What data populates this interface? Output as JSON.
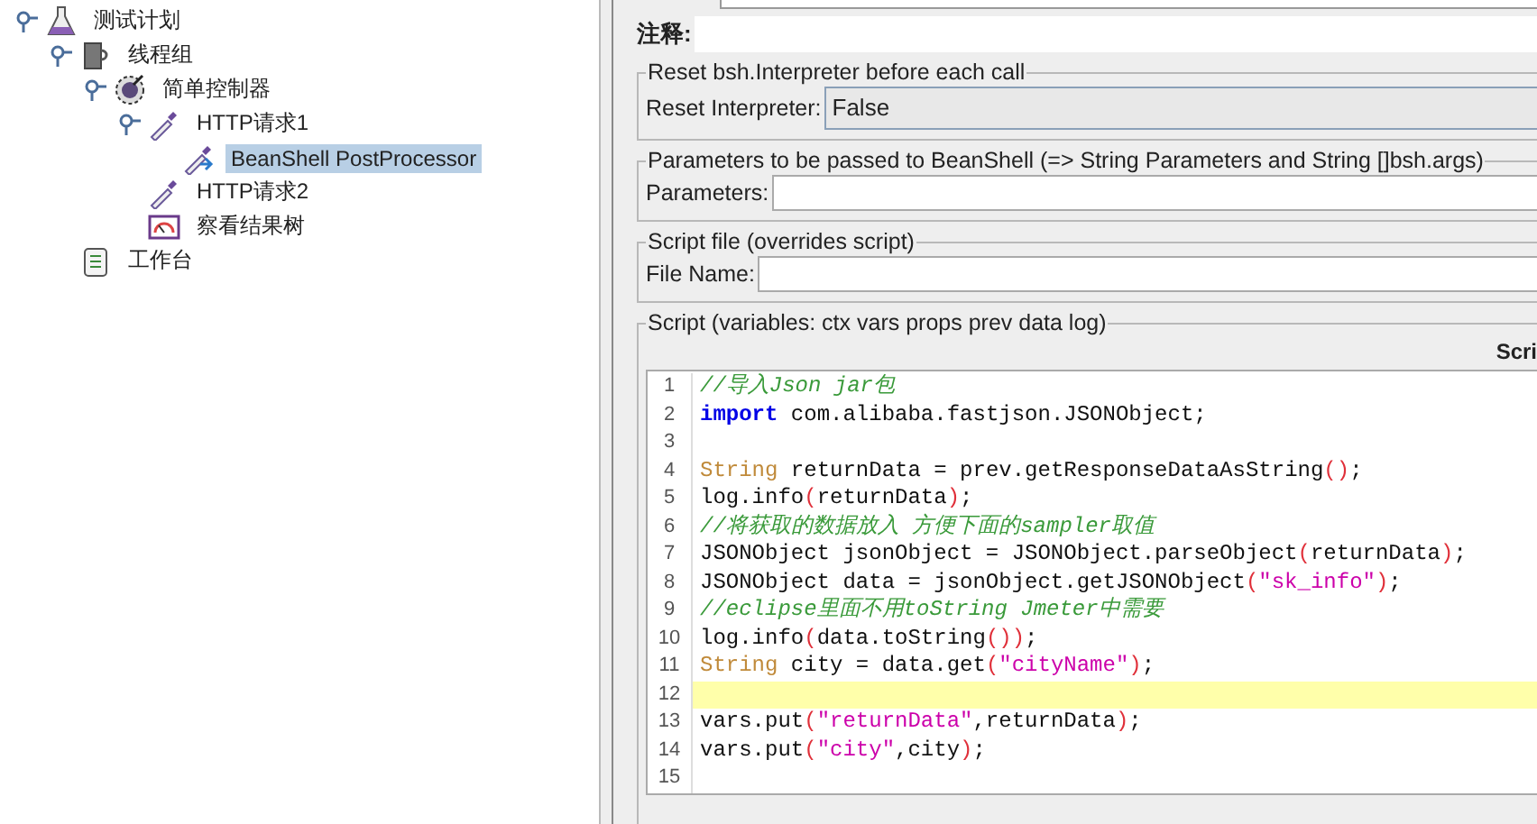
{
  "tree": [
    {
      "label": "测试计划",
      "kind": "flask",
      "selected": false,
      "children": [
        {
          "label": "线程组",
          "kind": "spool",
          "selected": false,
          "children": [
            {
              "label": "简单控制器",
              "kind": "gear",
              "selected": false,
              "children": [
                {
                  "label": "HTTP请求1",
                  "kind": "dropper",
                  "selected": false,
                  "children": [
                    {
                      "label": "BeanShell PostProcessor",
                      "kind": "dropper-arrow",
                      "selected": true
                    }
                  ]
                },
                {
                  "label": "HTTP请求2",
                  "kind": "dropper",
                  "selected": false
                },
                {
                  "label": "察看结果树",
                  "kind": "gauge",
                  "selected": false
                }
              ]
            }
          ]
        },
        {
          "label": "工作台",
          "kind": "clipboard",
          "selected": false
        }
      ]
    }
  ],
  "comment": {
    "label": "注释:"
  },
  "reset_section": {
    "title": "Reset bsh.Interpreter before each call",
    "label": "Reset Interpreter:",
    "value": "False"
  },
  "parameters_section": {
    "title": "Parameters to be passed to BeanShell (=> String Parameters and String []bsh.args)",
    "label": "Parameters:"
  },
  "script_file_section": {
    "title": "Script file (overrides script)",
    "label": "File Name:"
  },
  "script_section": {
    "title": "Script (variables: ctx vars props prev data log)",
    "column_label": "Scri",
    "lines": [
      {
        "number": "1",
        "current": false,
        "tokens": [
          {
            "kind": "comment",
            "text": "//导入Json jar包"
          }
        ]
      },
      {
        "number": "2",
        "current": false,
        "tokens": [
          {
            "kind": "keyword",
            "text": "import"
          },
          {
            "kind": "plain",
            "text": " com.alibaba.fastjson.JSONObject;"
          }
        ]
      },
      {
        "number": "3",
        "current": false
      },
      {
        "number": "4",
        "current": false,
        "tokens": [
          {
            "kind": "type",
            "text": "String"
          },
          {
            "kind": "plain",
            "text": " returnData = prev.getResponseDataAsString"
          },
          {
            "kind": "paren",
            "text": "()"
          },
          {
            "kind": "plain",
            "text": ";"
          }
        ]
      },
      {
        "number": "5",
        "current": false,
        "tokens": [
          {
            "kind": "plain",
            "text": "log.info"
          },
          {
            "kind": "paren",
            "text": "("
          },
          {
            "kind": "plain",
            "text": "returnData"
          },
          {
            "kind": "paren",
            "text": ")"
          },
          {
            "kind": "plain",
            "text": ";"
          }
        ]
      },
      {
        "number": "6",
        "current": false,
        "tokens": [
          {
            "kind": "comment",
            "text": "//将获取的数据放入 方便下面的sampler取值"
          }
        ]
      },
      {
        "number": "7",
        "current": false,
        "tokens": [
          {
            "kind": "plain",
            "text": "JSONObject jsonObject = JSONObject.parseObject"
          },
          {
            "kind": "paren",
            "text": "("
          },
          {
            "kind": "plain",
            "text": "returnData"
          },
          {
            "kind": "paren",
            "text": ")"
          },
          {
            "kind": "plain",
            "text": ";"
          }
        ]
      },
      {
        "number": "8",
        "current": false,
        "tokens": [
          {
            "kind": "plain",
            "text": "JSONObject data = jsonObject.getJSONObject"
          },
          {
            "kind": "paren",
            "text": "("
          },
          {
            "kind": "string",
            "text": "\"sk_info\""
          },
          {
            "kind": "paren",
            "text": ")"
          },
          {
            "kind": "plain",
            "text": ";"
          }
        ]
      },
      {
        "number": "9",
        "current": false,
        "tokens": [
          {
            "kind": "comment",
            "text": "//eclipse里面不用toString Jmeter中需要"
          }
        ]
      },
      {
        "number": "10",
        "current": false,
        "tokens": [
          {
            "kind": "plain",
            "text": "log.info"
          },
          {
            "kind": "paren",
            "text": "("
          },
          {
            "kind": "plain",
            "text": "data.toString"
          },
          {
            "kind": "paren",
            "text": "())"
          },
          {
            "kind": "plain",
            "text": ";"
          }
        ]
      },
      {
        "number": "11",
        "current": false,
        "tokens": [
          {
            "kind": "type",
            "text": "String"
          },
          {
            "kind": "plain",
            "text": " city = data.get"
          },
          {
            "kind": "paren",
            "text": "("
          },
          {
            "kind": "string",
            "text": "\"cityName\""
          },
          {
            "kind": "paren",
            "text": ")"
          },
          {
            "kind": "plain",
            "text": ";"
          }
        ]
      },
      {
        "number": "12",
        "current": true
      },
      {
        "number": "13",
        "current": false,
        "tokens": [
          {
            "kind": "plain",
            "text": "vars.put"
          },
          {
            "kind": "paren",
            "text": "("
          },
          {
            "kind": "string",
            "text": "\"returnData\""
          },
          {
            "kind": "plain",
            "text": ",returnData"
          },
          {
            "kind": "paren",
            "text": ")"
          },
          {
            "kind": "plain",
            "text": ";"
          }
        ]
      },
      {
        "number": "14",
        "current": false,
        "tokens": [
          {
            "kind": "plain",
            "text": "vars.put"
          },
          {
            "kind": "paren",
            "text": "("
          },
          {
            "kind": "string",
            "text": "\"city\""
          },
          {
            "kind": "plain",
            "text": ",city"
          },
          {
            "kind": "paren",
            "text": ")"
          },
          {
            "kind": "plain",
            "text": ";"
          }
        ]
      },
      {
        "number": "15",
        "current": false
      }
    ]
  }
}
